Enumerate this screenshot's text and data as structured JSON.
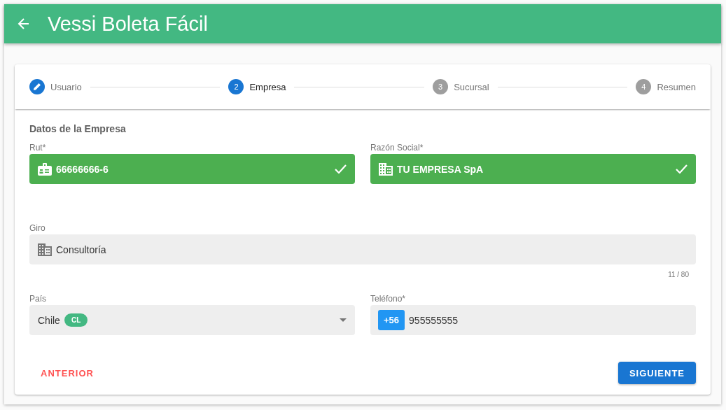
{
  "app_bar": {
    "title": "Vessi Boleta Fácil"
  },
  "steps": [
    {
      "label": "Usuario",
      "selected": false,
      "completed": true
    },
    {
      "number": "2",
      "label": "Empresa",
      "selected": true,
      "completed": false
    },
    {
      "number": "3",
      "label": "Sucursal",
      "selected": false,
      "completed": false
    },
    {
      "number": "4",
      "label": "Resumen",
      "selected": false,
      "completed": false
    }
  ],
  "section_title": "Datos de la Empresa",
  "fields": [
    {
      "kind": "text",
      "label": "Rut*",
      "value": "66666666-6",
      "valid": true
    },
    {
      "kind": "text",
      "label": "Razón Social*",
      "value": "TU EMPRESA SpA",
      "valid": true
    },
    {
      "kind": "text",
      "label": "Giro",
      "value": "Consultoría",
      "valid": false,
      "counter": "11 / 80"
    },
    {
      "kind": "select",
      "label": "País",
      "value": "Chile",
      "chip": "CL",
      "valid": false
    },
    {
      "kind": "phone",
      "label": "Teléfono*",
      "prefix": "+56",
      "value": "955555555",
      "valid": false
    }
  ],
  "buttons": {
    "back": "ANTERIOR",
    "next": "SIGUIENTE"
  }
}
